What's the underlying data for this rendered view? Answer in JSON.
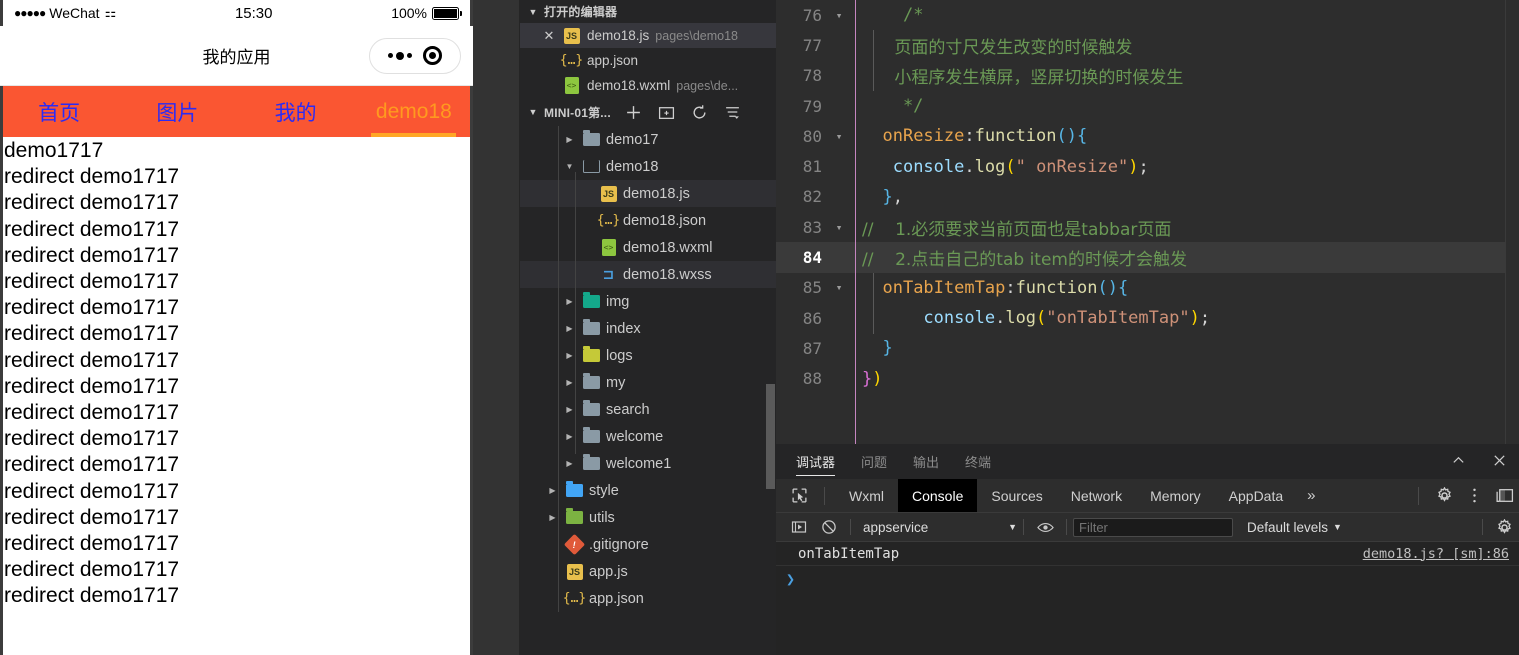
{
  "simulator": {
    "status_bar": {
      "carrier_dots": "●●●●●",
      "carrier": "WeChat",
      "wifi_icon": "wifi-icon",
      "time": "15:30",
      "battery_pct": "100%"
    },
    "nav": {
      "title": "我的应用",
      "capsule_menu_icon": "more-dots-icon",
      "capsule_close_icon": "target-circle-icon"
    },
    "tabs": [
      {
        "label": "首页",
        "active": false
      },
      {
        "label": "图片",
        "active": false
      },
      {
        "label": "我的",
        "active": false
      },
      {
        "label": "demo18",
        "active": true
      }
    ],
    "log_lines": [
      "demo1717",
      "redirect demo1717",
      "redirect demo1717",
      "redirect demo1717",
      "redirect demo1717",
      "redirect demo1717",
      "redirect demo1717",
      "redirect demo1717",
      "redirect demo1717",
      "redirect demo1717",
      "redirect demo1717",
      "redirect demo1717",
      "redirect demo1717",
      "redirect demo1717",
      "redirect demo1717",
      "redirect demo1717",
      "redirect demo1717",
      "redirect demo1717"
    ],
    "colors": {
      "tabbar_bg": "#fa5632",
      "tab_inactive": "#2b2bf5",
      "tab_active": "#ff9a1f"
    }
  },
  "explorer": {
    "open_editors": {
      "title": "打开的编辑器",
      "items": [
        {
          "name": "demo18.js",
          "path": "pages\\demo18",
          "icon": "js-file-icon",
          "selected": true,
          "closable": true
        },
        {
          "name": "app.json",
          "path": "",
          "icon": "json-file-icon",
          "selected": false,
          "closable": false
        },
        {
          "name": "demo18.wxml",
          "path": "pages\\de...",
          "icon": "wxml-file-icon",
          "selected": false,
          "closable": false
        }
      ]
    },
    "workspace": {
      "title": "MINI-01第...",
      "actions": [
        "new-file-icon",
        "new-folder-icon",
        "refresh-icon",
        "collapse-all-icon"
      ]
    },
    "tree": [
      {
        "label": "demo17",
        "type": "folder",
        "icon": "folder-icon",
        "depth": 2,
        "expanded": false,
        "selected": false
      },
      {
        "label": "demo18",
        "type": "folder",
        "icon": "folder-open-icon",
        "depth": 2,
        "expanded": true,
        "selected": false
      },
      {
        "label": "demo18.js",
        "type": "file",
        "icon": "js-file-icon",
        "depth": 3,
        "selected": true
      },
      {
        "label": "demo18.json",
        "type": "file",
        "icon": "json-file-icon",
        "depth": 3,
        "selected": false
      },
      {
        "label": "demo18.wxml",
        "type": "file",
        "icon": "wxml-file-icon",
        "depth": 3,
        "selected": false
      },
      {
        "label": "demo18.wxss",
        "type": "file",
        "icon": "wxss-file-icon",
        "depth": 3,
        "selected": true
      },
      {
        "label": "img",
        "type": "folder",
        "icon": "folder-image-icon",
        "depth": 2,
        "expanded": false,
        "selected": false
      },
      {
        "label": "index",
        "type": "folder",
        "icon": "folder-icon",
        "depth": 2,
        "expanded": false,
        "selected": false
      },
      {
        "label": "logs",
        "type": "folder",
        "icon": "folder-log-icon",
        "depth": 2,
        "expanded": false,
        "selected": false
      },
      {
        "label": "my",
        "type": "folder",
        "icon": "folder-icon",
        "depth": 2,
        "expanded": false,
        "selected": false
      },
      {
        "label": "search",
        "type": "folder",
        "icon": "folder-icon",
        "depth": 2,
        "expanded": false,
        "selected": false
      },
      {
        "label": "welcome",
        "type": "folder",
        "icon": "folder-icon",
        "depth": 2,
        "expanded": false,
        "selected": false
      },
      {
        "label": "welcome1",
        "type": "folder",
        "icon": "folder-icon",
        "depth": 2,
        "expanded": false,
        "selected": false
      },
      {
        "label": "style",
        "type": "folder",
        "icon": "folder-style-icon",
        "depth": 1,
        "expanded": false,
        "selected": false
      },
      {
        "label": "utils",
        "type": "folder",
        "icon": "folder-utils-icon",
        "depth": 1,
        "expanded": false,
        "selected": false
      },
      {
        "label": ".gitignore",
        "type": "file",
        "icon": "git-file-icon",
        "depth": 1,
        "selected": false
      },
      {
        "label": "app.js",
        "type": "file",
        "icon": "js-file-icon",
        "depth": 1,
        "selected": false
      },
      {
        "label": "app.json",
        "type": "file",
        "icon": "json-file-icon",
        "depth": 1,
        "selected": false
      }
    ]
  },
  "editor": {
    "current_line": 84,
    "lines": [
      {
        "n": "76",
        "fold": "▾",
        "tokens": [
          {
            "t": "    ",
            "c": "t-punc"
          },
          {
            "t": "/*",
            "c": "t-cmt"
          }
        ]
      },
      {
        "n": "77",
        "fold": "",
        "tokens": [
          {
            "t": "      页面的寸尺发生改变的时候触发",
            "c": "t-cmt-cn"
          }
        ]
      },
      {
        "n": "78",
        "fold": "",
        "tokens": [
          {
            "t": "      小程序发生横屏，竖屏切换的时候发生",
            "c": "t-cmt-cn"
          }
        ]
      },
      {
        "n": "79",
        "fold": "",
        "tokens": [
          {
            "t": "    */",
            "c": "t-cmt"
          }
        ]
      },
      {
        "n": "80",
        "fold": "▾",
        "tokens": [
          {
            "t": "  ",
            "c": "t-punc"
          },
          {
            "t": "onResize",
            "c": "t-prop"
          },
          {
            "t": ":",
            "c": "t-punc"
          },
          {
            "t": "function",
            "c": "t-fn"
          },
          {
            "t": "()",
            "c": "t-paren-b"
          },
          {
            "t": "{",
            "c": "t-paren-b"
          }
        ]
      },
      {
        "n": "81",
        "fold": "",
        "tokens": [
          {
            "t": "   ",
            "c": "t-punc"
          },
          {
            "t": "console",
            "c": "t-obj"
          },
          {
            "t": ".",
            "c": "t-punc"
          },
          {
            "t": "log",
            "c": "t-fn"
          },
          {
            "t": "(",
            "c": "t-paren-y"
          },
          {
            "t": "\" onResize\"",
            "c": "t-str"
          },
          {
            "t": ")",
            "c": "t-paren-y"
          },
          {
            "t": ";",
            "c": "t-punc"
          }
        ]
      },
      {
        "n": "82",
        "fold": "",
        "tokens": [
          {
            "t": "  ",
            "c": "t-punc"
          },
          {
            "t": "}",
            "c": "t-paren-b"
          },
          {
            "t": ",",
            "c": "t-punc"
          }
        ]
      },
      {
        "n": "83",
        "fold": "▾",
        "tokens": [
          {
            "t": "//    1.必须要求当前页面也是tabbar页面",
            "c": "t-cmt-cn"
          }
        ]
      },
      {
        "n": "84",
        "fold": "",
        "tokens": [
          {
            "t": "//    2.点击自己的tab item的时候才会触发",
            "c": "t-cmt-cn"
          }
        ]
      },
      {
        "n": "85",
        "fold": "▾",
        "tokens": [
          {
            "t": "  ",
            "c": "t-punc"
          },
          {
            "t": "onTabItemTap",
            "c": "t-prop"
          },
          {
            "t": ":",
            "c": "t-punc"
          },
          {
            "t": "function",
            "c": "t-fn"
          },
          {
            "t": "()",
            "c": "t-paren-b"
          },
          {
            "t": "{",
            "c": "t-paren-b"
          }
        ]
      },
      {
        "n": "86",
        "fold": "",
        "tokens": [
          {
            "t": "      ",
            "c": "t-punc"
          },
          {
            "t": "console",
            "c": "t-obj"
          },
          {
            "t": ".",
            "c": "t-punc"
          },
          {
            "t": "log",
            "c": "t-fn"
          },
          {
            "t": "(",
            "c": "t-paren-y"
          },
          {
            "t": "\"onTabItemTap\"",
            "c": "t-str"
          },
          {
            "t": ")",
            "c": "t-paren-y"
          },
          {
            "t": ";",
            "c": "t-punc"
          }
        ]
      },
      {
        "n": "87",
        "fold": "",
        "tokens": [
          {
            "t": "  ",
            "c": "t-punc"
          },
          {
            "t": "}",
            "c": "t-paren-b"
          }
        ]
      },
      {
        "n": "88",
        "fold": "",
        "tokens": [
          {
            "t": "}",
            "c": "t-paren-p"
          },
          {
            "t": ")",
            "c": "t-paren-y"
          }
        ]
      }
    ]
  },
  "panel": {
    "tabs": [
      {
        "label": "调试器",
        "active": true
      },
      {
        "label": "问题",
        "active": false
      },
      {
        "label": "输出",
        "active": false
      },
      {
        "label": "终端",
        "active": false
      }
    ],
    "actions": [
      {
        "icon": "chevron-up-icon",
        "glyph": "⌃"
      },
      {
        "icon": "close-icon",
        "glyph": "✕"
      }
    ],
    "devtools_tabs": [
      {
        "label": "Wxml",
        "active": false
      },
      {
        "label": "Console",
        "active": true
      },
      {
        "label": "Sources",
        "active": false
      },
      {
        "label": "Network",
        "active": false
      },
      {
        "label": "Memory",
        "active": false
      },
      {
        "label": "AppData",
        "active": false
      }
    ],
    "devtools_more": "»",
    "devtools_right_icons": [
      "gear-icon",
      "kebab-menu-icon",
      "dock-panel-icon"
    ],
    "console_toolbar": {
      "execute_icon": "execute-step-icon",
      "clear_icon": "clear-console-icon",
      "context": "appservice",
      "eye_icon": "eye-icon",
      "filter_placeholder": "Filter",
      "filter_value": "",
      "levels": "Default levels",
      "settings_icon": "gear-icon"
    },
    "console_messages": [
      {
        "text": "onTabItemTap",
        "source": "demo18.js? [sm]:86"
      }
    ],
    "prompt": "❯"
  }
}
